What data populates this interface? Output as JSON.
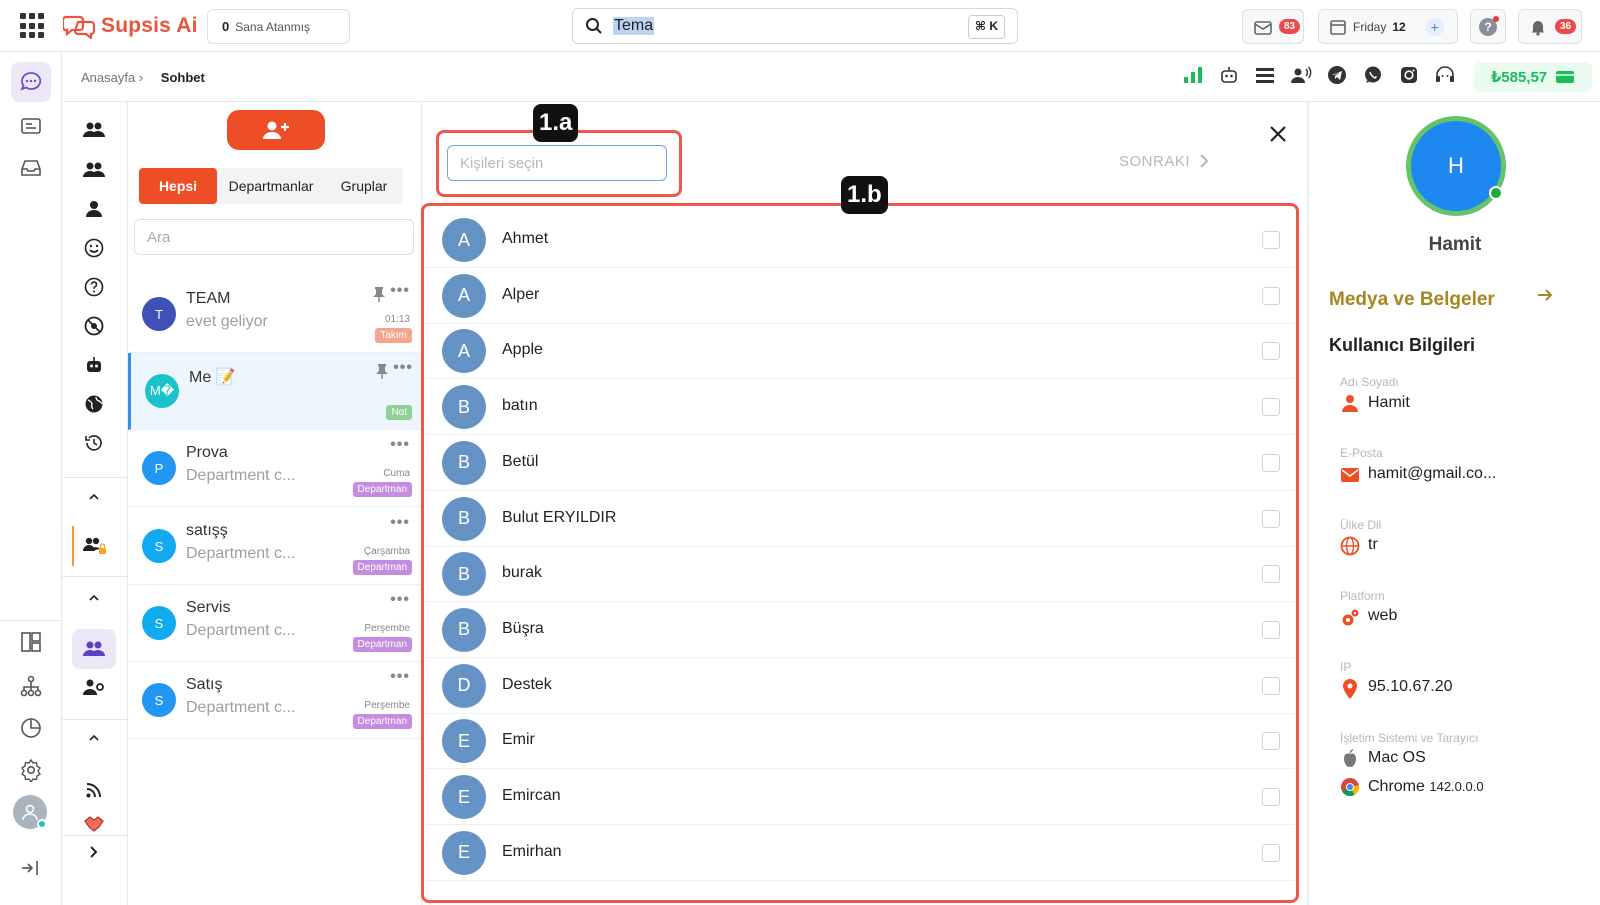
{
  "topbar": {
    "logo": "Supsis Ai",
    "assigned_count": "0",
    "assigned_label": "Sana Atanmış",
    "search_value": "Tema",
    "search_shortcut": "⌘ K",
    "mail_badge": "83",
    "day_label": "Friday",
    "day_number": "12",
    "notif_badge": "36"
  },
  "breadcrumb": {
    "home": "Anasayfa",
    "separator": "›",
    "current": "Sohbet"
  },
  "balance": "₺585,57",
  "chatlist": {
    "tabs": [
      "Hepsi",
      "Departmanlar",
      "Gruplar"
    ],
    "search_placeholder": "Ara",
    "items": [
      {
        "initial": "T",
        "name": "TEAM",
        "sub": "evet geliyor",
        "time": "01:13",
        "tag": "Takım",
        "color": "#3f51b5",
        "tagcolor": "#f4a48f"
      },
      {
        "initial": "M�",
        "name": "Me 📝",
        "sub": "",
        "time": "",
        "tag": "Not",
        "color": "#19c3c9",
        "tagcolor": "#8fd197"
      },
      {
        "initial": "P",
        "name": "Prova",
        "sub": "Department c...",
        "time": "Cuma",
        "tag": "Departman",
        "color": "#2196f3",
        "tagcolor": "#c58de0"
      },
      {
        "initial": "S",
        "name": "satışş",
        "sub": "Department c...",
        "time": "Çarşamba",
        "tag": "Departman",
        "color": "#11aaf0",
        "tagcolor": "#c58de0"
      },
      {
        "initial": "S",
        "name": "Servis",
        "sub": "Department c...",
        "time": "Perşembe",
        "tag": "Departman",
        "color": "#11aaf0",
        "tagcolor": "#c58de0"
      },
      {
        "initial": "S",
        "name": "Satış",
        "sub": "Department c...",
        "time": "Perşembe",
        "tag": "Departman",
        "color": "#2196f3",
        "tagcolor": "#c58de0"
      }
    ]
  },
  "main": {
    "select_placeholder": "Kişileri seçin",
    "next_label": "SONRAKI",
    "label_a": "1.a",
    "label_b": "1.b",
    "contacts": [
      {
        "initial": "A",
        "name": "Ahmet"
      },
      {
        "initial": "A",
        "name": "Alper"
      },
      {
        "initial": "A",
        "name": "Apple"
      },
      {
        "initial": "B",
        "name": "batın"
      },
      {
        "initial": "B",
        "name": "Betül"
      },
      {
        "initial": "B",
        "name": "Bulut ERYILDIR"
      },
      {
        "initial": "B",
        "name": "burak"
      },
      {
        "initial": "B",
        "name": "Büşra"
      },
      {
        "initial": "D",
        "name": "Destek"
      },
      {
        "initial": "E",
        "name": "Emir"
      },
      {
        "initial": "E",
        "name": "Emircan"
      },
      {
        "initial": "E",
        "name": "Emirhan"
      }
    ]
  },
  "profile": {
    "initial": "H",
    "name": "Hamit",
    "media_title": "Medya ve Belgeler",
    "info_title": "Kullanıcı Bilgileri",
    "fields": [
      {
        "label": "Adı Soyadı",
        "value": "Hamit"
      },
      {
        "label": "E-Posta",
        "value": "hamit@gmail.co..."
      },
      {
        "label": "Ülke Dil",
        "value": "tr"
      },
      {
        "label": "Platform",
        "value": "web"
      },
      {
        "label": "IP",
        "value": "95.10.67.20"
      },
      {
        "label": "İşletim Sistemi ve Tarayıcı",
        "value": "Mac OS"
      }
    ],
    "browser": "Chrome",
    "browser_version": "142.0.0.0"
  }
}
